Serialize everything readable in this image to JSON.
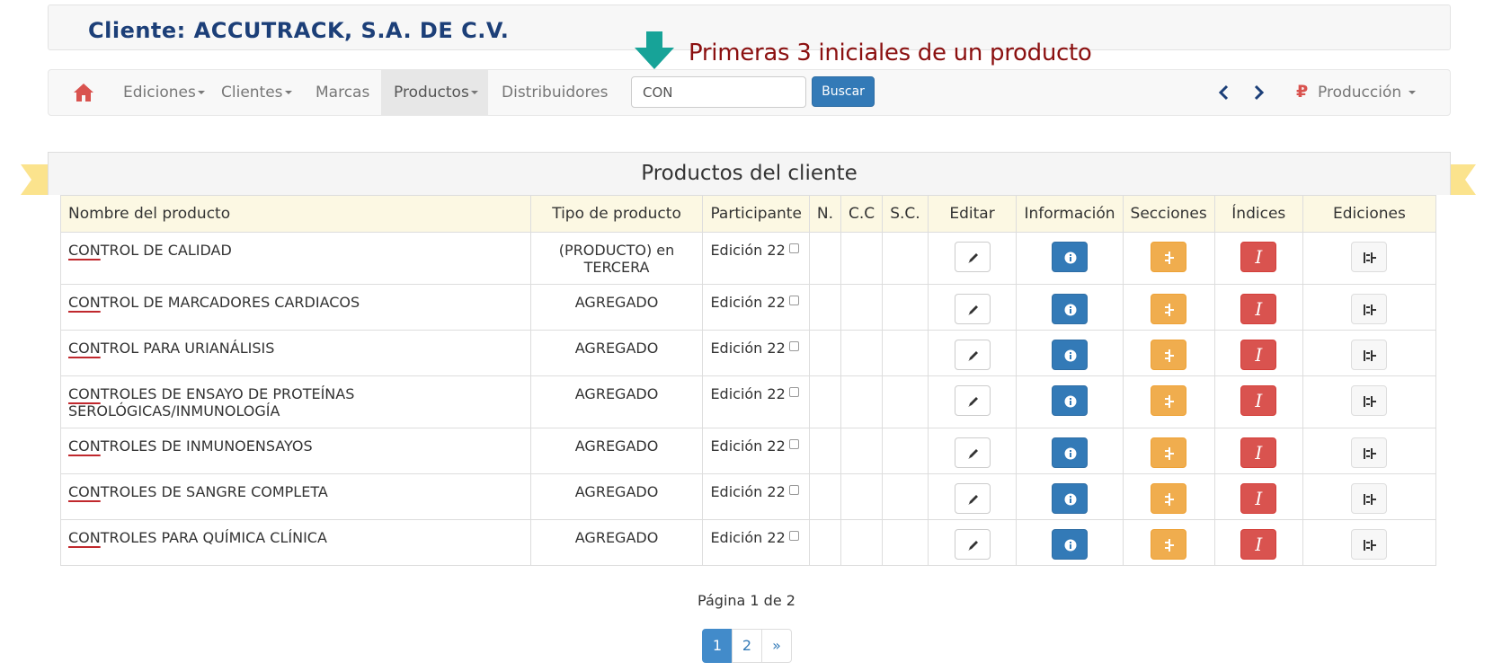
{
  "client": {
    "label": "Cliente: ACCUTRACK, S.A. DE C.V."
  },
  "annotation": {
    "text": "Primeras 3 iniciales de un producto"
  },
  "nav": {
    "items": [
      {
        "label": "Ediciones",
        "dropdown": true
      },
      {
        "label": "Clientes",
        "dropdown": true
      },
      {
        "label": "Marcas",
        "dropdown": false
      },
      {
        "label": "Productos",
        "dropdown": true,
        "active": true
      },
      {
        "label": "Distribuidores",
        "dropdown": false
      }
    ],
    "search_value": "CON",
    "search_button": "Buscar",
    "production_icon": "₽",
    "production_label": "Producción"
  },
  "panel": {
    "title": "Productos del cliente"
  },
  "table": {
    "headers": {
      "name": "Nombre del producto",
      "type": "Tipo de producto",
      "participant": "Participante",
      "n": "N.",
      "cc": "C.C",
      "sc": "S.C.",
      "edit": "Editar",
      "info": "Información",
      "sections": "Secciones",
      "indices": "Índices",
      "editions": "Ediciones"
    },
    "rows": [
      {
        "prefix": "CON",
        "rest": "TROL DE CALIDAD",
        "type": "(PRODUCTO) en TERCERA",
        "participant": "Edición 22"
      },
      {
        "prefix": "CON",
        "rest": "TROL DE MARCADORES CARDIACOS",
        "type": "AGREGADO",
        "participant": "Edición 22"
      },
      {
        "prefix": "CON",
        "rest": "TROL PARA URIANÁLISIS",
        "type": "AGREGADO",
        "participant": "Edición 22"
      },
      {
        "prefix": "CON",
        "rest": "TROLES DE ENSAYO DE PROTEÍNAS SEROLÓGICAS/INMUNOLOGÍA",
        "type": "AGREGADO",
        "participant": "Edición 22"
      },
      {
        "prefix": "CON",
        "rest": "TROLES DE INMUNOENSAYOS",
        "type": "AGREGADO",
        "participant": "Edición 22"
      },
      {
        "prefix": "CON",
        "rest": "TROLES DE SANGRE COMPLETA",
        "type": "AGREGADO",
        "participant": "Edición 22"
      },
      {
        "prefix": "CON",
        "rest": "TROLES PARA QUÍMICA CLÍNICA",
        "type": "AGREGADO",
        "participant": "Edición 22"
      }
    ],
    "index_glyph": "I"
  },
  "pagination": {
    "info": "Página 1 de 2",
    "pages": [
      "1",
      "2",
      "»"
    ],
    "active": "1"
  },
  "colors": {
    "client_title": "#1c3f78",
    "annotation": "#8b1010",
    "arrow": "#17a398",
    "primary": "#337ab7",
    "warning": "#f0ad4e",
    "danger": "#d9534f",
    "ribbon": "#fbe38d"
  }
}
